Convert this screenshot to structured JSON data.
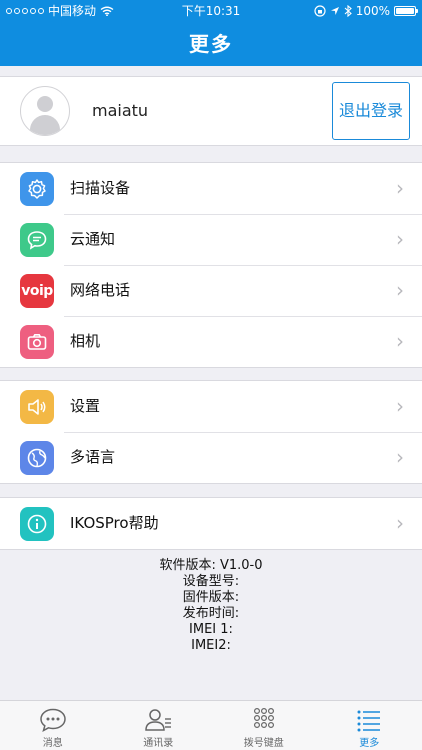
{
  "status_bar": {
    "carrier": "中国移动",
    "time": "下午10:31",
    "battery": "100%"
  },
  "header": {
    "title": "更多"
  },
  "profile": {
    "username": "maiatu",
    "logout_label": "退出登录"
  },
  "menu_group_1": [
    {
      "label": "扫描设备",
      "icon": "gear-icon",
      "color": "#3f95ea"
    },
    {
      "label": "云通知",
      "icon": "chat-bubble-icon",
      "color": "#3ec98a"
    },
    {
      "label": "网络电话",
      "icon": "voip-icon",
      "color": "#e6373f",
      "icon_text": "voip"
    },
    {
      "label": "相机",
      "icon": "camera-icon",
      "color": "#ee5f80"
    }
  ],
  "menu_group_2": [
    {
      "label": "设置",
      "icon": "speaker-icon",
      "color": "#f3b845"
    },
    {
      "label": "多语言",
      "icon": "globe-icon",
      "color": "#5d86e8"
    }
  ],
  "menu_group_3": [
    {
      "label": "IKOSPro帮助",
      "icon": "info-icon",
      "color": "#22c2c0"
    }
  ],
  "info": {
    "software_version": "软件版本: V1.0-0",
    "device_model": "设备型号:",
    "firmware_version": "固件版本:",
    "release_time": "发布时间:",
    "imei1": "IMEI 1:",
    "imei2": "IMEI2:"
  },
  "tabs": [
    {
      "label": "消息",
      "icon": "chat-icon"
    },
    {
      "label": "通讯录",
      "icon": "contacts-icon"
    },
    {
      "label": "拨号键盘",
      "icon": "dialpad-icon"
    },
    {
      "label": "更多",
      "icon": "list-icon",
      "active": true
    }
  ]
}
